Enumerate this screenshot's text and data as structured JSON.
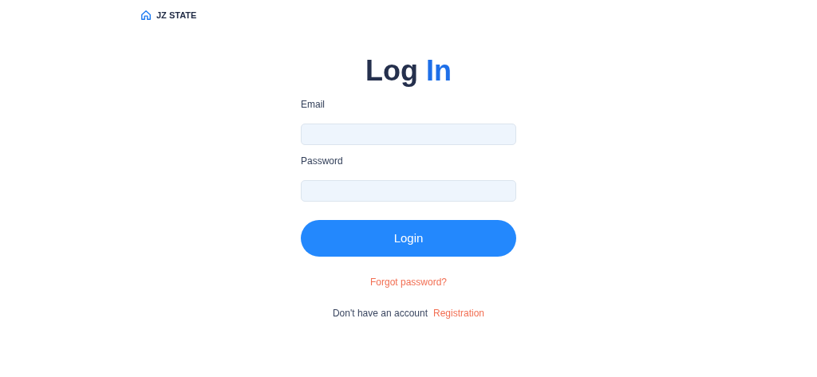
{
  "brand": {
    "name": "JZ STATE"
  },
  "title": {
    "main": "Log",
    "accent": "In"
  },
  "fields": [
    {
      "label": "Email"
    },
    {
      "label": "Password"
    }
  ],
  "submit": "Login",
  "forgot_link": "Forgot password?",
  "signup": {
    "prompt": "Don't have an account",
    "link": "Registration"
  }
}
